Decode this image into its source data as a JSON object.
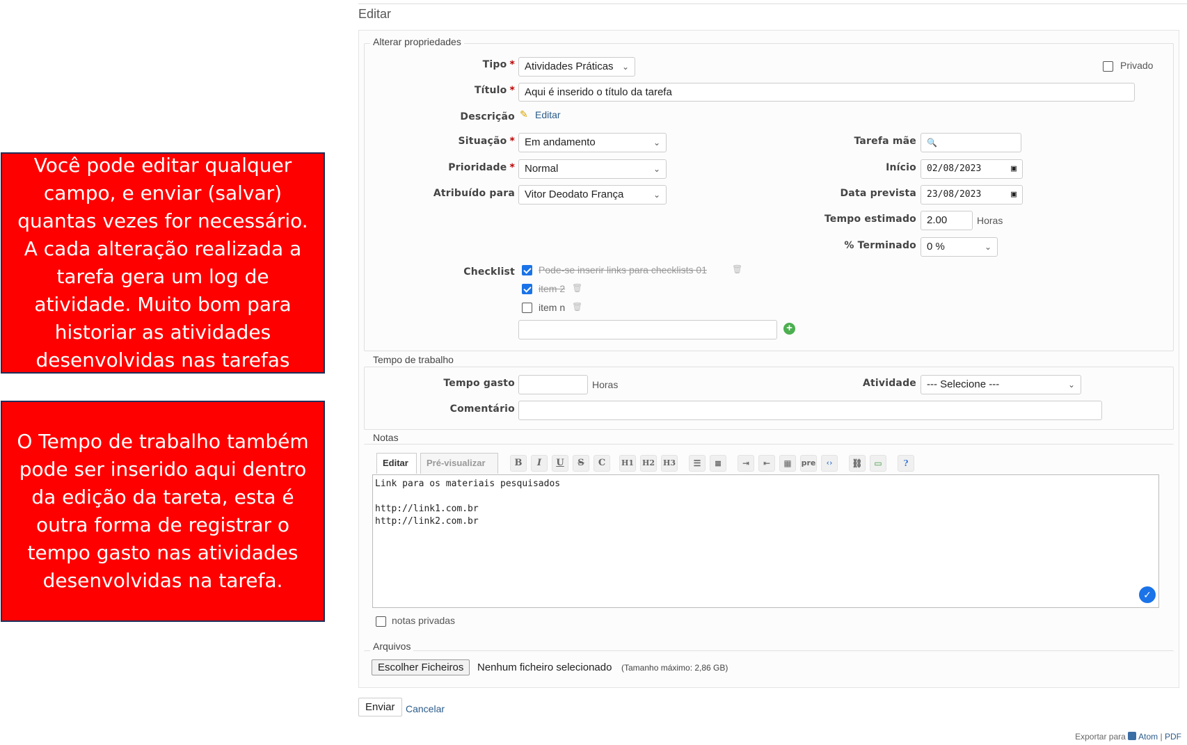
{
  "callouts": [
    "Você pode editar qualquer campo, e enviar (salvar) quantas vezes for necessário. A cada alteração realizada a tarefa gera um log de atividade. Muito bom para historiar as atividades desenvolvidas nas tarefas",
    "O Tempo de trabalho também pode ser inserido aqui dentro da edição da tareta, esta é outra forma de registrar o tempo gasto nas atividades desenvolvidas na tarefa."
  ],
  "page_title": "Editar",
  "properties": {
    "legend": "Alterar propriedades",
    "tipo": {
      "label": "Tipo",
      "value": "Atividades Práticas"
    },
    "privado_label": "Privado",
    "titulo": {
      "label": "Título",
      "value": "Aqui é inserido o título da tarefa"
    },
    "descricao": {
      "label": "Descrição",
      "edit_link": "Editar"
    },
    "situacao": {
      "label": "Situação",
      "value": "Em andamento"
    },
    "prioridade": {
      "label": "Prioridade",
      "value": "Normal"
    },
    "atribuido": {
      "label": "Atribuído para",
      "value": "Vitor Deodato França"
    },
    "tarefa_mae": {
      "label": "Tarefa mãe",
      "value": ""
    },
    "inicio": {
      "label": "Início",
      "value": "02/08/2023"
    },
    "data_prevista": {
      "label": "Data prevista",
      "value": "23/08/2023"
    },
    "tempo_estimado": {
      "label": "Tempo estimado",
      "value": "2.00",
      "unit": "Horas"
    },
    "terminado": {
      "label": "% Terminado",
      "value": "0 %"
    },
    "checklist": {
      "label": "Checklist",
      "items": [
        {
          "text": "Pode-se inserir links para checklists 01",
          "done": true
        },
        {
          "text": "item 2",
          "done": true
        },
        {
          "text": "item n",
          "done": false
        }
      ],
      "new_item_value": ""
    }
  },
  "work_time": {
    "legend": "Tempo de trabalho",
    "tempo_gasto": {
      "label": "Tempo gasto",
      "value": "",
      "unit": "Horas"
    },
    "atividade": {
      "label": "Atividade",
      "value": "--- Selecione ---"
    },
    "comentario": {
      "label": "Comentário",
      "value": ""
    }
  },
  "notes": {
    "legend": "Notas",
    "tabs": [
      "Editar",
      "Pré-visualizar"
    ],
    "toolbar": [
      "B",
      "I",
      "U",
      "S",
      "C",
      "H1",
      "H2",
      "H3",
      "ul",
      "ol",
      "indent",
      "outdent",
      "table",
      "pre",
      "code",
      "link",
      "image",
      "help"
    ],
    "content": "Link para os materiais pesquisados\n\nhttp://link1.com.br\nhttp://link2.com.br",
    "private_label": "notas privadas"
  },
  "files": {
    "legend": "Arquivos",
    "choose_button": "Escolher Ficheiros",
    "none_selected": "Nenhum ficheiro selecionado",
    "max_size": "(Tamanho máximo: 2,86 GB)"
  },
  "actions": {
    "submit": "Enviar",
    "cancel": "Cancelar"
  },
  "footer": {
    "export_label": "Exportar para",
    "atom": "Atom",
    "separator": "|",
    "pdf": "PDF"
  },
  "colors": {
    "callout_bg": "#ff0000",
    "link": "#2a5b8a",
    "check_accent": "#1a73e8"
  }
}
